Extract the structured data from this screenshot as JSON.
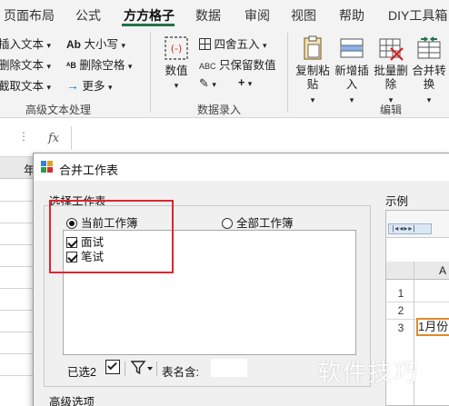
{
  "ribbon_tabs": [
    {
      "label": "页面布局"
    },
    {
      "label": "公式"
    },
    {
      "label": "方方格子"
    },
    {
      "label": "数据"
    },
    {
      "label": "审阅"
    },
    {
      "label": "视图"
    },
    {
      "label": "帮助"
    },
    {
      "label": "DIY工具箱"
    }
  ],
  "active_tab": "方方格子",
  "advanced_text": {
    "items": [
      "插入文本",
      "删除文本",
      "截取文本"
    ],
    "case_label": "大小写",
    "delete_spaces_label": "删除空格",
    "more_label": "更多",
    "group_label": "高级文本处理"
  },
  "data_entry": {
    "numeric_label": "数值",
    "round_label": "四舍五入",
    "keep_values_label": "只保留数值",
    "plus_label": "+",
    "group_label": "数据录入"
  },
  "edit_group": {
    "buttons": [
      {
        "label": "复制粘贴"
      },
      {
        "label": "新增插入"
      },
      {
        "label": "批量删除"
      },
      {
        "label": "合并转换"
      }
    ],
    "group_label": "编辑"
  },
  "formula_bar": {
    "fx": "fx"
  },
  "sheet": {
    "col_header": "年"
  },
  "dialog": {
    "title": "合并工作表",
    "select_section_label": "选择工作表",
    "radio_current": "当前工作簿",
    "radio_all": "全部工作簿",
    "sheets": [
      {
        "label": "面试",
        "checked": true
      },
      {
        "label": "笔试",
        "checked": true
      }
    ],
    "selected_count_label": "已选2",
    "table_name_label": "表名含:",
    "table_name_value": "",
    "advanced_options_label": "高级选项",
    "preview_label": "示例",
    "preview_col": "A",
    "preview_rows": [
      "1",
      "2",
      "3"
    ],
    "preview_cell_text": "1月份"
  },
  "watermark": "软件技巧",
  "colors": {
    "accent": "#217346",
    "highlight": "#e0242c"
  }
}
